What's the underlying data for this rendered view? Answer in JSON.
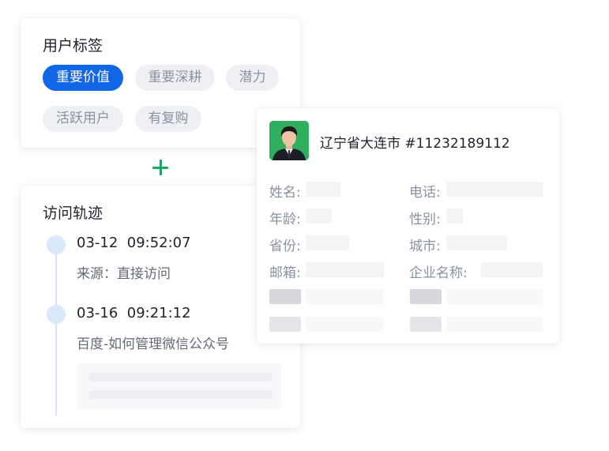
{
  "user_tags": {
    "title": "用户标签",
    "tags": [
      "重要价值",
      "重要深耕",
      "潜力",
      "活跃用户",
      "有复购"
    ]
  },
  "visit_track": {
    "title": "访问轨迹",
    "entries": [
      {
        "time": "03-12  09:52:07",
        "desc": "来源：直接访问"
      },
      {
        "time": "03-16  09:21:12",
        "desc": "百度-如何管理微信公众号"
      }
    ]
  },
  "profile": {
    "header": "辽宁省大连市 #11232189112",
    "labels": {
      "name": "姓名:",
      "phone": "电话:",
      "age": "年龄:",
      "gender": "性别:",
      "province": "省份:",
      "city": "城市:",
      "email": "邮箱:",
      "company": "企业名称:"
    }
  },
  "colors": {
    "accent": "#1166e8",
    "plus": "#20a365",
    "avatar_bg": "#2fae5e"
  },
  "icons": [
    "plus-icon",
    "avatar"
  ]
}
